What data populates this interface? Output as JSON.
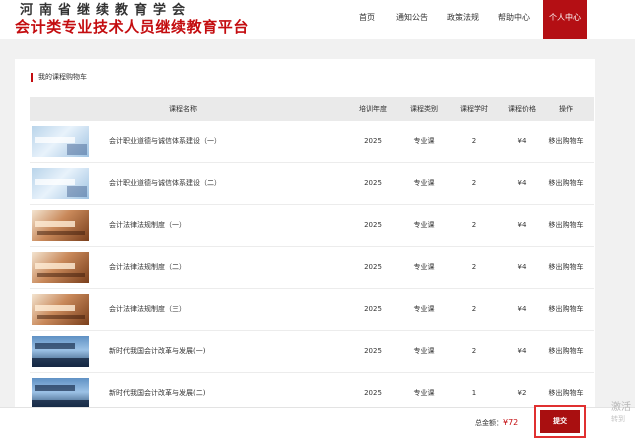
{
  "header": {
    "logo_line1": "河南省继续教育学会",
    "logo_line2": "会计类专业技术人员继续教育平台",
    "nav": [
      "首页",
      "通知公告",
      "政策法规",
      "帮助中心",
      "个人中心"
    ]
  },
  "cart": {
    "title": "我的课程购物车",
    "columns": [
      "课程名称",
      "培训年度",
      "课程类别",
      "课程学时",
      "课程价格",
      "操作"
    ],
    "rows": [
      {
        "name": "会计职业道德与诚信体系建设（一）",
        "year": "2025",
        "type": "专业课",
        "hours": "2",
        "price": "¥4",
        "action": "移出购物车",
        "thumb": "blue"
      },
      {
        "name": "会计职业道德与诚信体系建设（二）",
        "year": "2025",
        "type": "专业课",
        "hours": "2",
        "price": "¥4",
        "action": "移出购物车",
        "thumb": "blue"
      },
      {
        "name": "会计法律法规制度（一）",
        "year": "2025",
        "type": "专业课",
        "hours": "2",
        "price": "¥4",
        "action": "移出购物车",
        "thumb": "brown"
      },
      {
        "name": "会计法律法规制度（二）",
        "year": "2025",
        "type": "专业课",
        "hours": "2",
        "price": "¥4",
        "action": "移出购物车",
        "thumb": "brown"
      },
      {
        "name": "会计法律法规制度（三）",
        "year": "2025",
        "type": "专业课",
        "hours": "2",
        "price": "¥4",
        "action": "移出购物车",
        "thumb": "brown"
      },
      {
        "name": "新时代我国会计改革与发展(一)",
        "year": "2025",
        "type": "专业课",
        "hours": "2",
        "price": "¥4",
        "action": "移出购物车",
        "thumb": "city"
      },
      {
        "name": "新时代我国会计改革与发展(二)",
        "year": "2025",
        "type": "专业课",
        "hours": "1",
        "price": "¥2",
        "action": "移出购物车",
        "thumb": "city"
      }
    ]
  },
  "footer": {
    "total_label": "总金额：",
    "total_amount": "¥72",
    "submit_label": "提交"
  },
  "watermark": {
    "line1": "激活",
    "line2": "转到"
  }
}
